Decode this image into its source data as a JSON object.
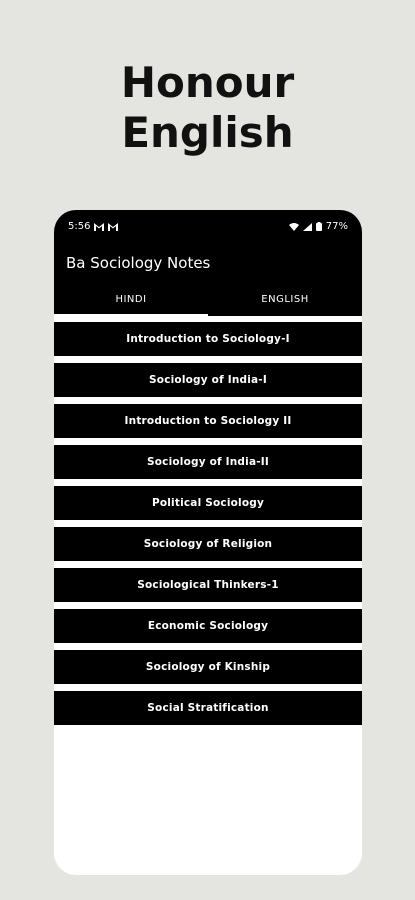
{
  "promo": {
    "title_line1": "Honour",
    "title_line2": "English"
  },
  "status_bar": {
    "time": "5:56",
    "notification_icons": [
      "gmail-icon",
      "gmail-icon"
    ],
    "right_icons": [
      "wifi-icon",
      "signal-icon",
      "battery-icon"
    ],
    "battery": "77%"
  },
  "app_bar": {
    "title": "Ba Sociology Notes"
  },
  "tabs": [
    {
      "label": "HINDI",
      "active": true
    },
    {
      "label": "ENGLISH",
      "active": false
    }
  ],
  "list": {
    "items": [
      {
        "label": "Introduction to Sociology-I"
      },
      {
        "label": "Sociology of India-I"
      },
      {
        "label": "Introduction to Sociology II"
      },
      {
        "label": "Sociology of India-II"
      },
      {
        "label": "Political Sociology"
      },
      {
        "label": "Sociology of Religion"
      },
      {
        "label": "Sociological Thinkers-1"
      },
      {
        "label": "Economic Sociology"
      },
      {
        "label": "Sociology of Kinship"
      },
      {
        "label": "Social Stratification"
      }
    ]
  }
}
